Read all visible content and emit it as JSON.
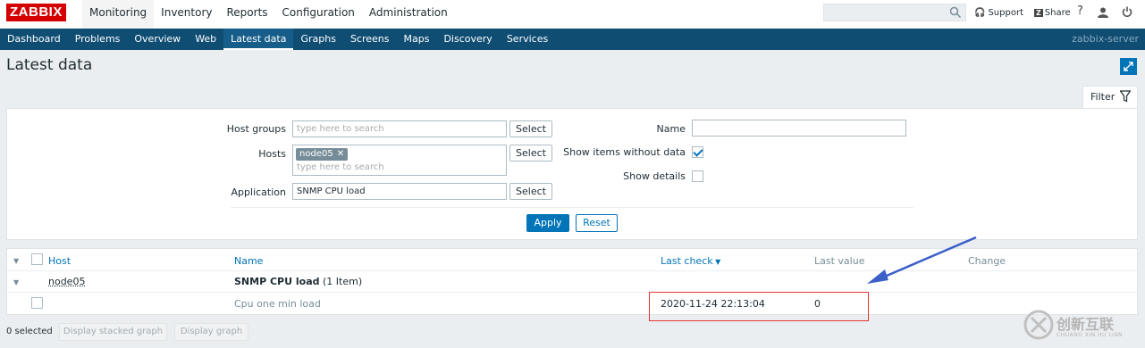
{
  "header": {
    "logo": "ZABBIX",
    "main_nav": [
      "Monitoring",
      "Inventory",
      "Reports",
      "Configuration",
      "Administration"
    ],
    "search_placeholder": "",
    "support_label": "Support",
    "share_label": "Share",
    "share_badge": "Z"
  },
  "subnav": {
    "items": [
      "Dashboard",
      "Problems",
      "Overview",
      "Web",
      "Latest data",
      "Graphs",
      "Screens",
      "Maps",
      "Discovery",
      "Services"
    ],
    "active": "Latest data",
    "server": "zabbix-server"
  },
  "page": {
    "title": "Latest data"
  },
  "filter": {
    "tab_label": "Filter",
    "host_groups_label": "Host groups",
    "host_groups_placeholder": "type here to search",
    "hosts_label": "Hosts",
    "hosts_chip": "node05",
    "hosts_placeholder": "type here to search",
    "application_label": "Application",
    "application_value": "SNMP CPU load",
    "select_label": "Select",
    "name_label": "Name",
    "name_value": "",
    "show_without_data_label": "Show items without data",
    "show_without_data": true,
    "show_details_label": "Show details",
    "show_details": false,
    "apply_label": "Apply",
    "reset_label": "Reset"
  },
  "table": {
    "columns": {
      "host": "Host",
      "name": "Name",
      "last_check": "Last check",
      "last_value": "Last value",
      "change": "Change"
    },
    "group": {
      "host": "node05",
      "app_name": "SNMP CPU load",
      "app_count": "(1 Item)"
    },
    "rows": [
      {
        "name": "Cpu one min load",
        "last_check": "2020-11-24 22:13:04",
        "last_value": "0",
        "change": ""
      }
    ]
  },
  "footer": {
    "selected": "0 selected",
    "stacked_graph": "Display stacked graph",
    "graph": "Display graph"
  },
  "watermark": {
    "title": "创新互联",
    "subtitle": "CHUANG XIN HU LIAN"
  },
  "colors": {
    "brand": "#d40000",
    "nav": "#0f4d73",
    "accent": "#0275b8",
    "annotation": "#e53333",
    "arrow": "#3b5fc9"
  }
}
